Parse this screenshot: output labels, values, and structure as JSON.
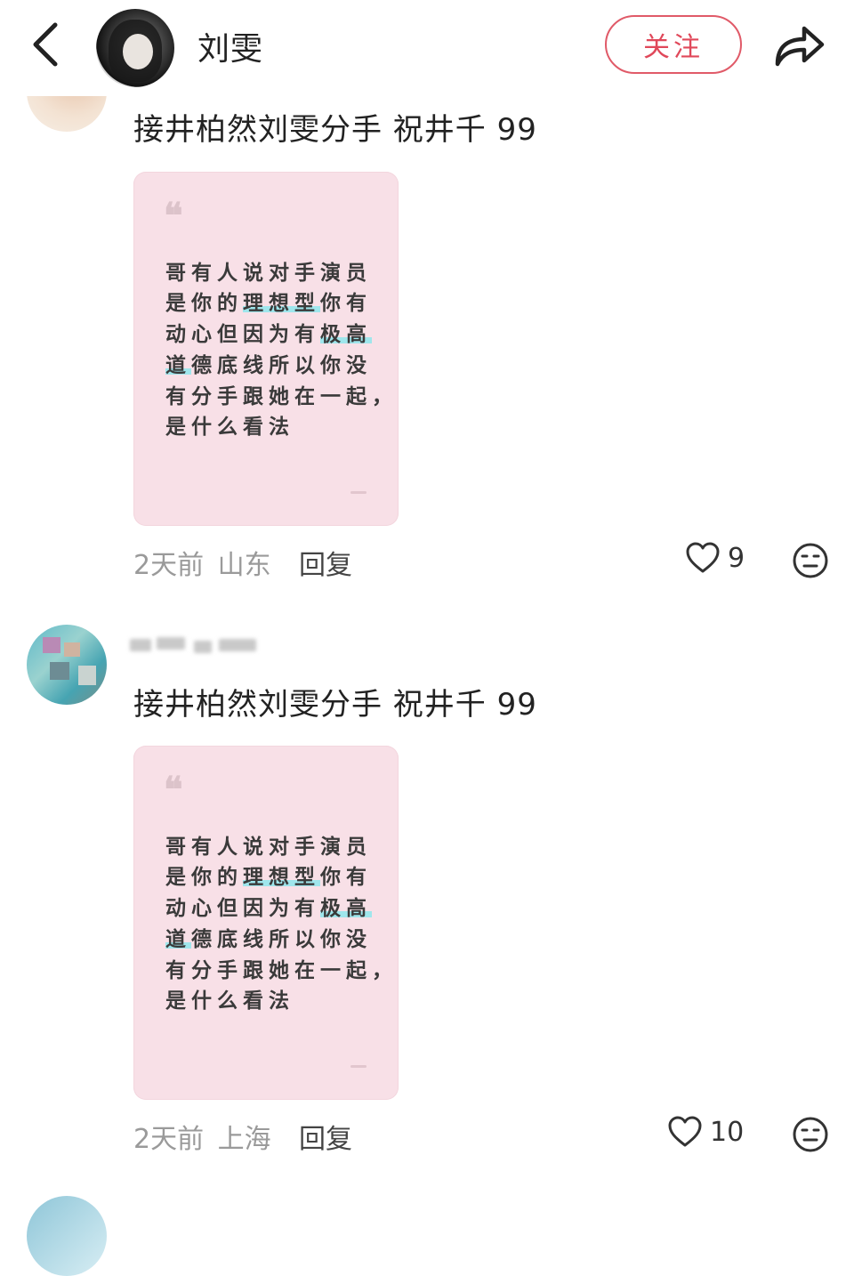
{
  "header": {
    "name": "刘雯",
    "follow_label": "关注"
  },
  "comments": [
    {
      "text": "接井柏然刘雯分手 祝井千 99",
      "card_lines": [
        "哥有人说对手演员",
        "是你的理想型你有",
        "动心但因为有极高",
        "道德底线所以你没",
        "有分手跟她在一起，",
        "是什么看法"
      ],
      "time": "2天前",
      "location": "山东",
      "reply_label": "回复",
      "likes": "9"
    },
    {
      "text": "接井柏然刘雯分手 祝井千 99",
      "card_lines": [
        "哥有人说对手演员",
        "是你的理想型你有",
        "动心但因为有极高",
        "道德底线所以你没",
        "有分手跟她在一起，",
        "是什么看法"
      ],
      "time": "2天前",
      "location": "上海",
      "reply_label": "回复",
      "likes": "10"
    }
  ],
  "colors": {
    "accent": "#e0485a",
    "card_bg": "#f8e0e7",
    "highlight": "#9fe6ec",
    "meta_text": "#9a9a9a"
  },
  "icons": {
    "back": "chevron-left-icon",
    "share": "share-arrow-icon",
    "like": "heart-icon",
    "dislike": "neutral-face-icon",
    "quote": "quote-icon"
  }
}
